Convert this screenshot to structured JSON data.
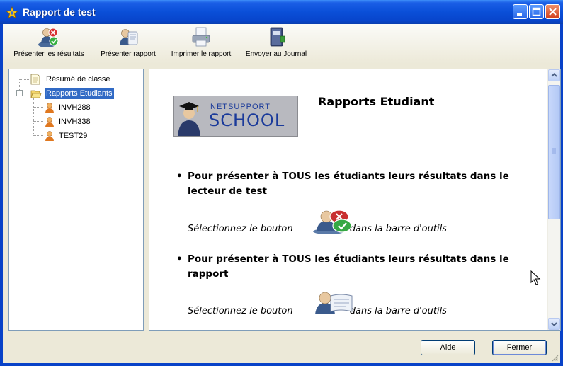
{
  "window": {
    "title": "Rapport de test"
  },
  "toolbar": {
    "items": [
      {
        "label": "Présenter les résultats",
        "icon": "present-results-icon"
      },
      {
        "label": "Présenter rapport",
        "icon": "present-report-icon"
      },
      {
        "label": "Imprimer le rapport",
        "icon": "printer-icon"
      },
      {
        "label": "Envoyer au Journal",
        "icon": "journal-icon"
      }
    ]
  },
  "tree": {
    "root1": "Résumé de classe",
    "root2": "Rapports Etudiants",
    "students": [
      "INVH288",
      "INVH338",
      "TEST29"
    ]
  },
  "content": {
    "logo_line1": "NETSUPPORT",
    "logo_line2": "SCHOOL",
    "heading": "Rapports Etudiant",
    "bullet1": "Pour présenter à TOUS les étudiants leurs résultats dans le lecteur de test",
    "bullet2": "Pour présenter à TOUS les étudiants leurs résultats dans le rapport",
    "select_prefix": "Sélectionnez le bouton",
    "select_suffix": "dans la barre d'outils"
  },
  "buttons": {
    "help": "Aide",
    "close": "Fermer"
  },
  "colors": {
    "titlebar": "#0a4fd8",
    "selection": "#316ac5",
    "face": "#ece9d8"
  }
}
